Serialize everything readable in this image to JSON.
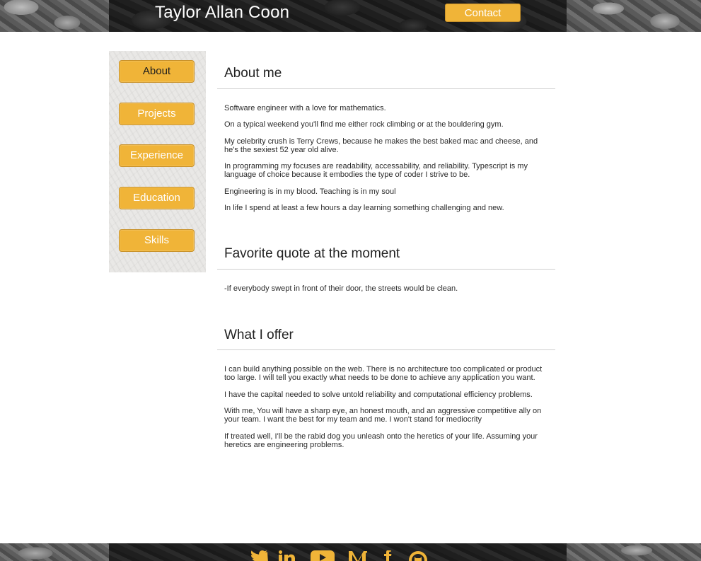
{
  "header": {
    "title": "Taylor Allan Coon",
    "contact_label": "Contact"
  },
  "sidebar": {
    "items": [
      {
        "label": "About",
        "active": true
      },
      {
        "label": "Projects",
        "active": false
      },
      {
        "label": "Experience",
        "active": false
      },
      {
        "label": "Education",
        "active": false
      },
      {
        "label": "Skills",
        "active": false
      }
    ]
  },
  "sections": {
    "about": {
      "title": "About me",
      "paragraphs": [
        "Software engineer with a love for mathematics.",
        "On a typical weekend you'll find me either rock climbing or at the bouldering gym.",
        "My celebrity crush is Terry Crews, because he makes the best baked mac and cheese, and he's the sexiest 52 year old alive.",
        "In programming my focuses are readability, accessability, and reliability. Typescript is my language of choice because it embodies the type of coder I strive to be.",
        "Engineering is in my blood. Teaching is in my soul",
        "In life I spend at least a few hours a day learning something challenging and new."
      ]
    },
    "quote": {
      "title": "Favorite quote at the moment",
      "text": "-If everybody swept in front of their door, the streets would be clean."
    },
    "offer": {
      "title": "What I offer",
      "paragraphs": [
        "I can build anything possible on the web. There is no architecture too complicated or product too large. I will tell you exactly what needs to be done to achieve any application you want.",
        "I have the capital needed to solve untold reliability and computational efficiency problems.",
        "With me, You will have a sharp eye, an honest mouth, and an aggressive competitive ally on your team. I want the best for my team and me. I won't stand for mediocrity",
        "If treated well, I'll be the rabid dog you unleash onto the heretics of your life. Assuming your heretics are engineering problems."
      ]
    }
  },
  "footer": {
    "social_icons": [
      "twitter-icon",
      "linkedin-icon",
      "youtube-icon",
      "medium-icon",
      "facebook-icon",
      "github-icon"
    ]
  },
  "colors": {
    "accent": "#f0b438",
    "header_dark": "#222222"
  }
}
